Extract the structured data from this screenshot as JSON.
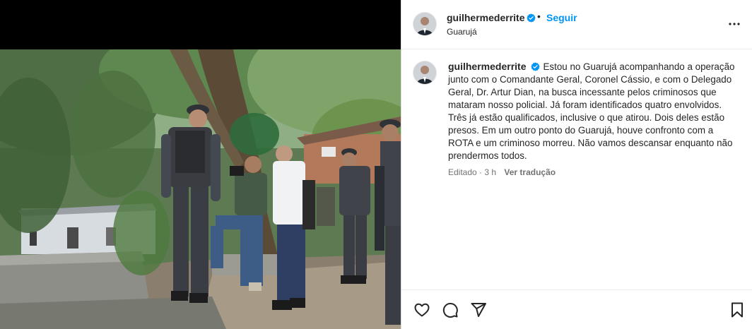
{
  "post": {
    "username": "guilhermederrite",
    "follow_label": "Seguir",
    "location": "Guarujá",
    "separator": "•",
    "caption_text": "Estou no Guarujá acompanhando a operação junto com o Comandante Geral, Coronel Cássio, e com o Delegado Geral, Dr. Artur Dian, na busca incessante pelos criminosos que mataram nosso policial. Já foram identificados quatro envolvidos. Três já estão qualificados, inclusive o que atirou. Dois deles estão presos. Em um outro ponto do Guarujá, houve confronto com a ROTA e um criminoso morreu. Não vamos descansar enquanto não prendermos todos.",
    "edited_label": "Editado · 3 h",
    "translate_label": "Ver tradução"
  },
  "icons": {
    "verified": "verified-badge-icon",
    "more": "more-options-icon",
    "like": "heart-icon",
    "comment": "comment-icon",
    "share": "share-icon",
    "save": "bookmark-icon"
  },
  "colors": {
    "accent": "#0095f6",
    "text": "#262626",
    "muted": "#737373",
    "border": "#dbdbdb"
  }
}
